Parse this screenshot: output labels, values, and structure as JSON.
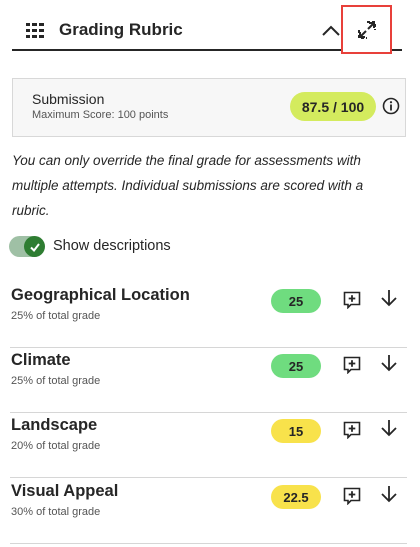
{
  "header": {
    "title": "Grading Rubric",
    "icons": {
      "rubric": "rubric-grid-icon",
      "collapse": "chevron-up-icon",
      "expand": "expand-arrows-icon"
    }
  },
  "submission": {
    "title": "Submission",
    "max_score": "Maximum Score: 100 points",
    "score": "87.5 / 100",
    "score_color": "#d4eb5e",
    "info_icon": "info-icon"
  },
  "note": "You can only override the final grade for assessments with multiple attempts. Individual submissions are scored with a rubric.",
  "descriptions_toggle": {
    "label": "Show descriptions",
    "on": true,
    "color": "#2e7d32"
  },
  "criteria": [
    {
      "name": "Geographical Location",
      "weight": "25% of total grade",
      "score": "25",
      "score_color": "#6fdc7f"
    },
    {
      "name": "Climate",
      "weight": "25% of total grade",
      "score": "25",
      "score_color": "#6fdc7f"
    },
    {
      "name": "Landscape",
      "weight": "20% of total grade",
      "score": "15",
      "score_color": "#f8e24b"
    },
    {
      "name": "Visual Appeal",
      "weight": "30% of total grade",
      "score": "22.5",
      "score_color": "#f8e24b"
    }
  ],
  "colors": {
    "accent_border": "#e8403a",
    "green_score": "#6fdc7f",
    "yellow_score": "#f8e24b"
  }
}
